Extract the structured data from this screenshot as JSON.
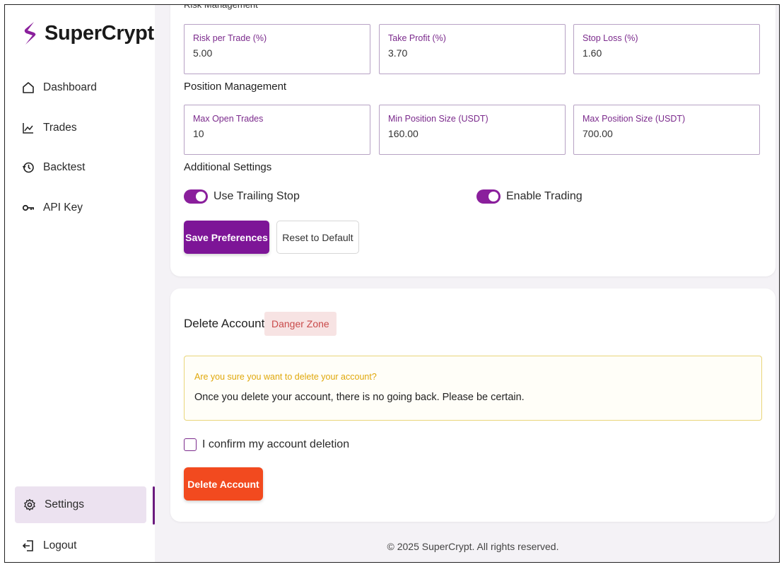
{
  "brand": {
    "name": "SuperCrypt",
    "accent": "#7d1597",
    "logo_color": "#8a1f9c"
  },
  "sidebar": {
    "items": [
      {
        "label": "Dashboard",
        "icon": "home-icon"
      },
      {
        "label": "Trades",
        "icon": "chart-line-icon"
      },
      {
        "label": "Backtest",
        "icon": "history-icon"
      },
      {
        "label": "API Key",
        "icon": "key-icon"
      }
    ],
    "settings_label": "Settings",
    "logout_label": "Logout"
  },
  "risk": {
    "heading": "Risk Management",
    "fields": [
      {
        "label": "Risk per Trade (%)",
        "value": "5.00"
      },
      {
        "label": "Take Profit (%)",
        "value": "3.70"
      },
      {
        "label": "Stop Loss (%)",
        "value": "1.60"
      }
    ]
  },
  "position": {
    "heading": "Position Management",
    "fields": [
      {
        "label": "Max Open Trades",
        "value": "10"
      },
      {
        "label": "Min Position Size (USDT)",
        "value": "160.00"
      },
      {
        "label": "Max Position Size (USDT)",
        "value": "700.00"
      }
    ]
  },
  "additional": {
    "heading": "Additional Settings",
    "toggles": [
      {
        "label": "Use Trailing Stop",
        "on": true
      },
      {
        "label": "Enable Trading",
        "on": true
      }
    ]
  },
  "actions": {
    "save_label": "Save Preferences",
    "reset_label": "Reset to Default"
  },
  "delete": {
    "title": "Delete Account",
    "badge": "Danger Zone",
    "warning_title": "Are you sure you want to delete your account?",
    "warning_text": "Once you delete your account, there is no going back. Please be certain.",
    "confirm_label": "I confirm my account deletion",
    "confirm_checked": false,
    "button_label": "Delete Account",
    "danger_color": "#f24a1f",
    "warning_color": "#e0a80c"
  },
  "footer": {
    "text": "© 2025 SuperCrypt. All rights reserved."
  }
}
